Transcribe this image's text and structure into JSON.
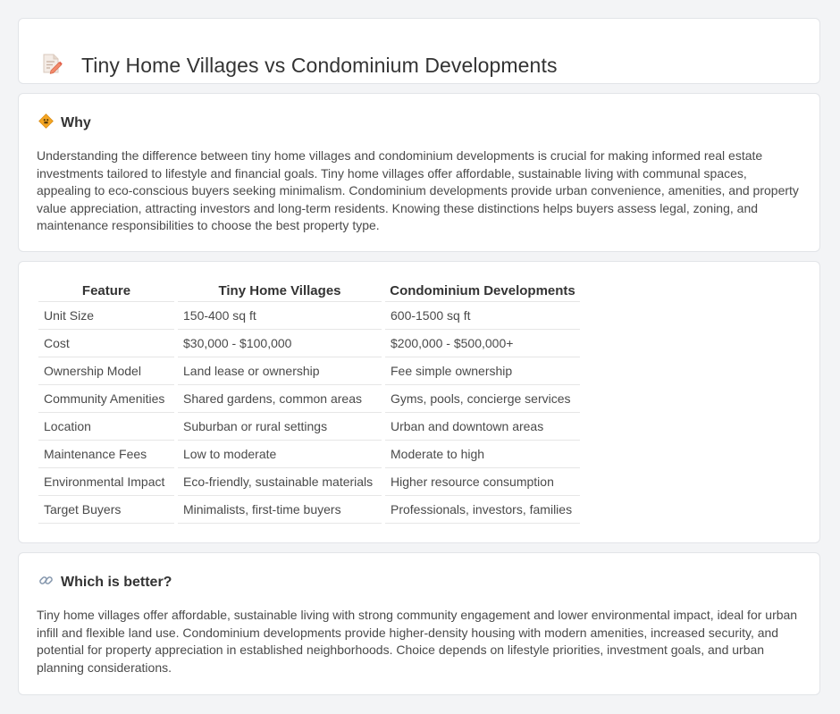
{
  "header": {
    "title": "Tiny Home Villages vs Condominium Developments",
    "icon": "document-pencil-icon"
  },
  "why": {
    "icon": "diamond-sign-icon",
    "heading": "Why",
    "body": "Understanding the difference between tiny home villages and condominium developments is crucial for making informed real estate investments tailored to lifestyle and financial goals. Tiny home villages offer affordable, sustainable living with communal spaces, appealing to eco-conscious buyers seeking minimalism. Condominium developments provide urban convenience, amenities, and property value appreciation, attracting investors and long-term residents. Knowing these distinctions helps buyers assess legal, zoning, and maintenance responsibilities to choose the best property type."
  },
  "table": {
    "headers": [
      "Feature",
      "Tiny Home Villages",
      "Condominium Developments"
    ],
    "rows": [
      [
        "Unit Size",
        "150-400 sq ft",
        "600-1500 sq ft"
      ],
      [
        "Cost",
        "$30,000 - $100,000",
        "$200,000 - $500,000+"
      ],
      [
        "Ownership Model",
        "Land lease or ownership",
        "Fee simple ownership"
      ],
      [
        "Community Amenities",
        "Shared gardens, common areas",
        "Gyms, pools, concierge services"
      ],
      [
        "Location",
        "Suburban or rural settings",
        "Urban and downtown areas"
      ],
      [
        "Maintenance Fees",
        "Low to moderate",
        "Moderate to high"
      ],
      [
        "Environmental Impact",
        "Eco-friendly, sustainable materials",
        "Higher resource consumption"
      ],
      [
        "Target Buyers",
        "Minimalists, first-time buyers",
        "Professionals, investors, families"
      ]
    ]
  },
  "better": {
    "icon": "link-icon",
    "heading": "Which is better?",
    "body": "Tiny home villages offer affordable, sustainable living with strong community engagement and lower environmental impact, ideal for urban infill and flexible land use. Condominium developments provide higher-density housing with modern amenities, increased security, and potential for property appreciation in established neighborhoods. Choice depends on lifestyle priorities, investment goals, and urban planning considerations."
  }
}
